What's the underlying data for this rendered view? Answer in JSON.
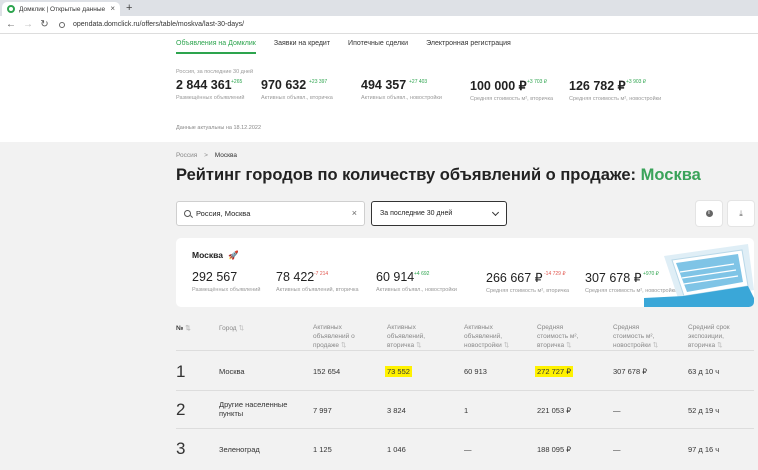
{
  "browser": {
    "tab_title": "Домклик | Открытые данные",
    "tab_close": "×",
    "new_tab": "+",
    "url": "opendata.domclick.ru/offers/table/moskva/last-30-days/"
  },
  "nav": {
    "tabs": [
      {
        "label": "Объявления на Домклик"
      },
      {
        "label": "Заявки на кредит"
      },
      {
        "label": "Ипотечные сделки"
      },
      {
        "label": "Электронная регистрация"
      }
    ]
  },
  "summary": {
    "period_note": "Россия, за последние 30 дней",
    "stats": [
      {
        "value": "2 844 361",
        "delta": "+265",
        "label": "Размещённых объявлений"
      },
      {
        "value": "970 632",
        "delta": "+23 397",
        "label": "Активных объявл., вторичка"
      },
      {
        "value": "494 357",
        "delta": "+27 403",
        "label": "Активных объявл., новостройки"
      },
      {
        "value": "100 000 ₽",
        "delta": "+3 703 ₽",
        "label": "Средняя стоимость м², вторичка"
      },
      {
        "value": "126 782 ₽",
        "delta": "+3 903 ₽",
        "label": "Средняя стоимость м², новостройки"
      }
    ],
    "updated": "Данные актуальны на 18.12.2022"
  },
  "breadcrumb": {
    "root": "Россия",
    "separator": ">",
    "current": "Москва"
  },
  "heading": {
    "prefix": "Рейтинг городов по количеству объявлений о продаже:",
    "city": "Москва"
  },
  "filters": {
    "search_value": "Россия, Москва",
    "clear": "×",
    "period_value": "За последние 30 дней",
    "info": "i",
    "download": "⤓"
  },
  "city_card": {
    "title": "Москва",
    "rocket": "🚀",
    "stats": [
      {
        "value": "292 567",
        "delta": "",
        "label": "Размещённых объявлений",
        "negative": false
      },
      {
        "value": "78 422",
        "delta": "-7 214",
        "label": "Активных объявлений, вторичка",
        "negative": true
      },
      {
        "value": "60 914",
        "delta": "+4 692",
        "label": "Активных объявл., новостройки",
        "negative": false
      },
      {
        "value": "266 667 ₽",
        "delta": "-14 729 ₽",
        "label": "Средняя стоимость м², вторичка",
        "negative": true
      },
      {
        "value": "307 678 ₽",
        "delta": "+970 ₽",
        "label": "Средняя стоимость м², новостройки",
        "negative": false
      }
    ]
  },
  "table": {
    "headers": {
      "rank": "№",
      "city": "Город",
      "posted": "Активных\nобъявлений о\nпродаже",
      "active_secondary": "Активных\nобъявлений,\nвторичка",
      "active_new": "Активных\nобъявлений,\nновостройки",
      "price_secondary": "Средняя\nстоимость м²,\nвторичка",
      "price_new": "Средняя\nстоимость м²,\nновостройки",
      "exposure": "Средний срок\nэкспозиции,\nвторичка"
    },
    "sort_glyph": "⇅",
    "rows": [
      {
        "rank": "1",
        "city": "Москва",
        "posted": "152 654",
        "active_secondary": "73 552",
        "active_new": "60 913",
        "price_secondary": "272 727 ₽",
        "price_new": "307 678 ₽",
        "exposure": "63 д 10 ч"
      },
      {
        "rank": "2",
        "city": "Другие населенные\nпункты",
        "posted": "7 997",
        "active_secondary": "3 824",
        "active_new": "1",
        "price_secondary": "221 053 ₽",
        "price_new": "—",
        "exposure": "52 д 19 ч"
      },
      {
        "rank": "3",
        "city": "Зеленоград",
        "posted": "1 125",
        "active_secondary": "1 046",
        "active_new": "—",
        "price_secondary": "188 095 ₽",
        "price_new": "—",
        "exposure": "97 д 16 ч"
      }
    ],
    "highlight_color": "#fff200"
  },
  "colors": {
    "accent": "#2da44e",
    "negative": "#e0554d"
  }
}
